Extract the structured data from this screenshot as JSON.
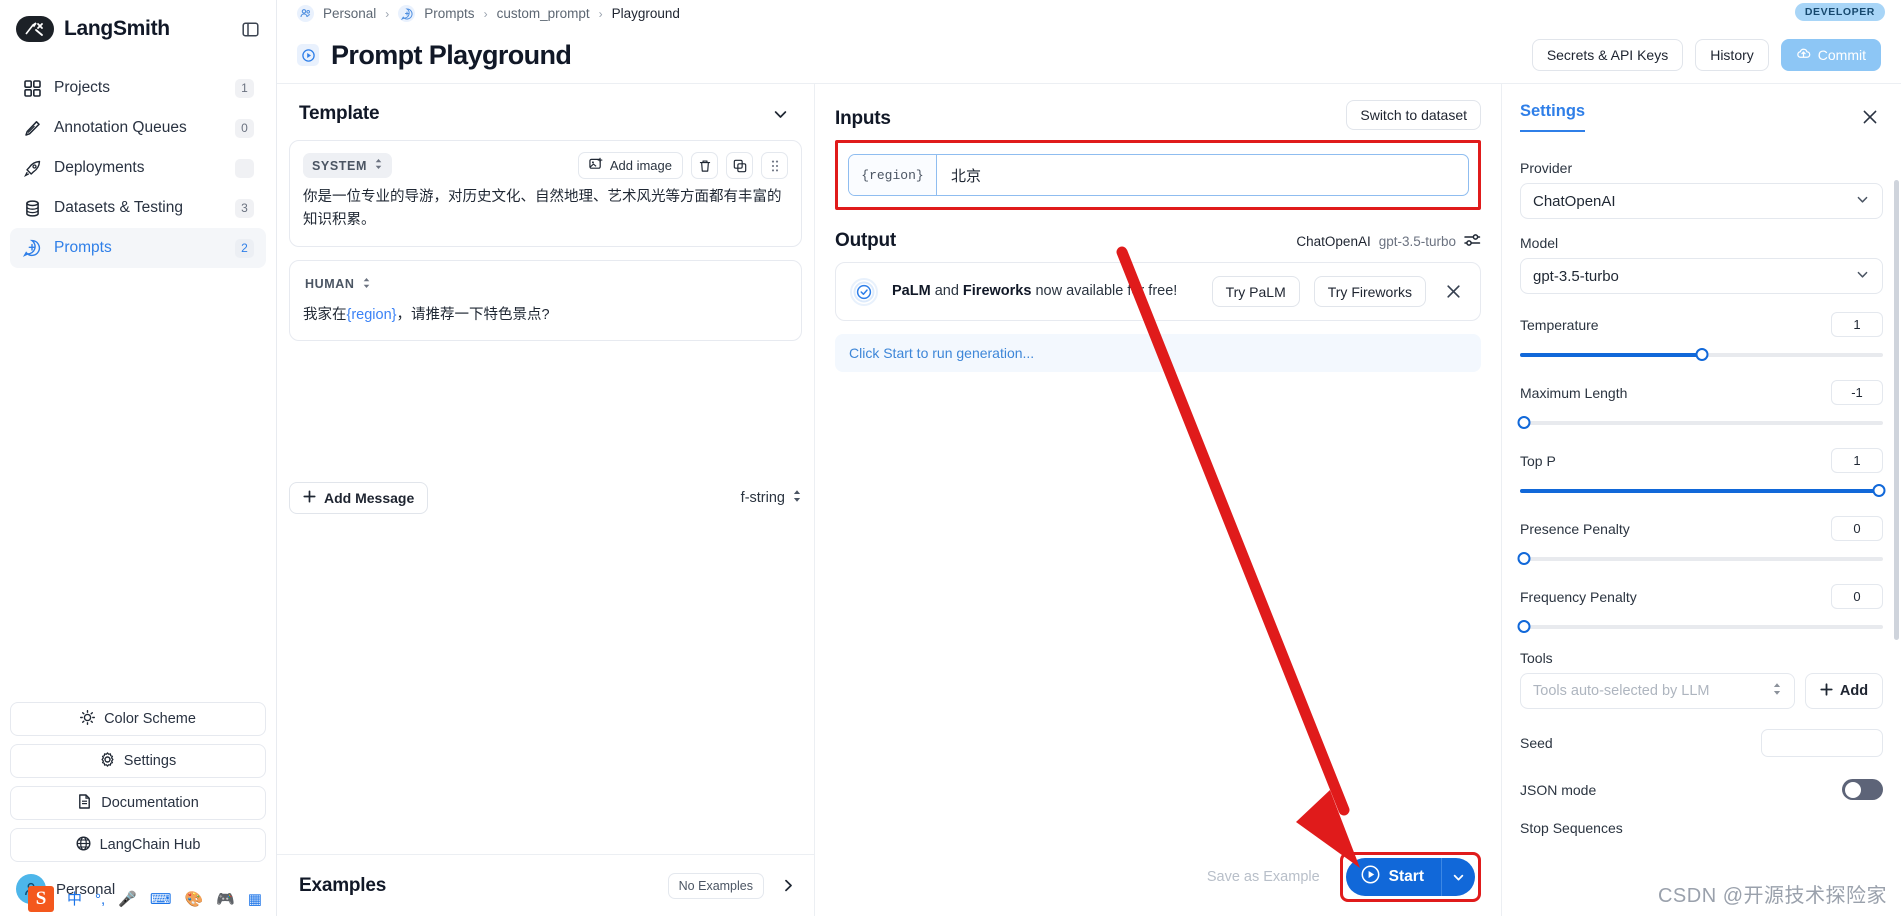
{
  "brand": {
    "name": "LangSmith",
    "logo_icon": "langsmith-logo-icon",
    "panel_toggle_icon": "panel-collapse-icon"
  },
  "sidebar": {
    "items": [
      {
        "label": "Projects",
        "badge": "1",
        "icon": "grid-icon",
        "active": false
      },
      {
        "label": "Annotation Queues",
        "badge": "0",
        "icon": "pencil-icon",
        "active": false
      },
      {
        "label": "Deployments",
        "badge": "",
        "icon": "rocket-icon",
        "active": false
      },
      {
        "label": "Datasets & Testing",
        "badge": "3",
        "icon": "database-icon",
        "active": false
      },
      {
        "label": "Prompts",
        "badge": "2",
        "icon": "prompt-bubble-icon",
        "active": true
      }
    ],
    "bottom": [
      {
        "label": "Color Scheme",
        "icon": "sun-icon"
      },
      {
        "label": "Settings",
        "icon": "gear-icon"
      },
      {
        "label": "Documentation",
        "icon": "document-icon"
      },
      {
        "label": "LangChain Hub",
        "icon": "globe-icon"
      }
    ],
    "user": {
      "name": "Personal",
      "avatar_icon": "user-avatar-icon"
    }
  },
  "ime": {
    "logo": "S",
    "items": [
      "中",
      "°,",
      "mic-icon",
      "keyboard-icon",
      "paint-icon",
      "emoji-icon",
      "apps-icon"
    ]
  },
  "header": {
    "breadcrumb": [
      {
        "label": "Personal",
        "icon": "people-icon"
      },
      {
        "label": "Prompts",
        "icon": "prompt-bubble-icon"
      },
      {
        "label": "custom_prompt",
        "icon": ""
      },
      {
        "label": "Playground",
        "icon": ""
      }
    ],
    "separator": "›",
    "plan_badge": "DEVELOPER",
    "title": "Prompt Playground",
    "title_icon": "play-circle-icon",
    "buttons": {
      "secrets": "Secrets & API Keys",
      "history": "History",
      "commit": "Commit",
      "commit_icon": "cloud-upload-icon"
    }
  },
  "template": {
    "title": "Template",
    "collapse_icon": "chevron-down-icon",
    "messages": [
      {
        "role": "SYSTEM",
        "text": "你是一位专业的导游，对历史文化、自然地理、艺术风光等方面都有丰富的知识积累。",
        "add_image_label": "Add image",
        "add_image_icon": "image-plus-icon",
        "delete_icon": "trash-icon",
        "copy_icon": "copy-icon",
        "drag_icon": "drag-handle-icon"
      },
      {
        "role": "HUMAN",
        "text_prefix": "我家在",
        "text_variable": "{region}",
        "text_suffix": "，请推荐一下特色景点?"
      }
    ],
    "add_message_label": "Add Message",
    "add_message_icon": "plus-icon",
    "format": "f-string",
    "format_icon": "chevron-updown-icon"
  },
  "examples": {
    "title": "Examples",
    "no_examples_label": "No Examples",
    "next_icon": "chevron-right-icon"
  },
  "inputs": {
    "title": "Inputs",
    "switch_label": "Switch to dataset",
    "rows": [
      {
        "key": "{region}",
        "value": "北京"
      }
    ]
  },
  "output": {
    "title": "Output",
    "model_provider": "ChatOpenAI",
    "model_name": "gpt-3.5-turbo",
    "model_settings_icon": "sliders-icon",
    "promo": {
      "icon": "check-circle-icon",
      "bold1": "PaLM",
      "mid": " and ",
      "bold2": "Fireworks",
      "tail": " now available for free!",
      "btn1": "Try PaLM",
      "btn2": "Try Fireworks",
      "close_icon": "close-icon"
    },
    "run_hint": "Click Start to run generation...",
    "save_example_label": "Save as Example",
    "start_label": "Start",
    "start_icon": "play-icon",
    "start_caret_icon": "chevron-down-icon"
  },
  "settings": {
    "tab": "Settings",
    "close_icon": "close-icon",
    "provider_label": "Provider",
    "provider_value": "ChatOpenAI",
    "model_label": "Model",
    "model_value": "gpt-3.5-turbo",
    "dropdown_icon": "chevron-down-icon",
    "params": [
      {
        "name": "Temperature",
        "value": "1",
        "percent": 50
      },
      {
        "name": "Maximum Length",
        "value": "-1",
        "percent": 0
      },
      {
        "name": "Top P",
        "value": "1",
        "percent": 100
      },
      {
        "name": "Presence Penalty",
        "value": "0",
        "percent": 0
      },
      {
        "name": "Frequency Penalty",
        "value": "0",
        "percent": 0
      }
    ],
    "tools_label": "Tools",
    "tools_placeholder": "Tools auto-selected by LLM",
    "tools_icon": "chevron-updown-icon",
    "add_label": "Add",
    "add_icon": "plus-icon",
    "seed_label": "Seed",
    "seed_value": "",
    "json_mode_label": "JSON mode",
    "stop_sequences_label": "Stop Sequences"
  },
  "watermark": "CSDN @开源技术探险家",
  "colors": {
    "accent": "#1168d9",
    "link": "#2f7fe8",
    "highlight": "#e01b1b",
    "badge": "#a8d5f7"
  }
}
